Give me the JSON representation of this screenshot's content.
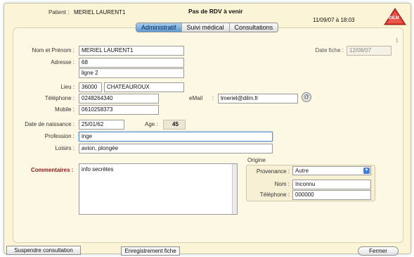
{
  "header": {
    "patient_label": "Patient :",
    "patient_name": "MERIEL LAURENT1",
    "rdv_status": "Pas de RDV à venir",
    "datetime": "11/09/07 à 18:03",
    "logo_text": "DILM"
  },
  "tabs": [
    {
      "label": "Administratif",
      "active": true
    },
    {
      "label": "Suivi médical",
      "active": false
    },
    {
      "label": "Consultations",
      "active": false
    }
  ],
  "page_number": "1",
  "form": {
    "nom_label": "Nom et Prénom :",
    "nom_value": "MERIEL LAURENT1",
    "adresse_label": "Adresse :",
    "adresse_line1": "68",
    "adresse_line2": "ligne 2",
    "lieu_label": "Lieu :",
    "lieu_cp": "36000",
    "lieu_ville": "CHATEAUROUX",
    "telephone_label": "Téléphone :",
    "telephone_value": "0248264340",
    "email_label": "eMail",
    "email_sep": ":",
    "email_value": "lmeriel@dilm.fr",
    "email_btn": "@",
    "mobile_label": "Mobile :",
    "mobile_value": "0610258373",
    "naissance_label": "Date de naissance :",
    "naissance_value": "25/01/62",
    "age_label": "Age :",
    "age_value": "45",
    "profession_label": "Profession :",
    "profession_value": "inge",
    "loisirs_label": "Loisirs :",
    "loisirs_value": "avion, plongée",
    "date_fiche_label": "Date fiche :",
    "date_fiche_value": "12/08/07",
    "commentaires_label": "Commentaires :",
    "commentaires_value": "info secrètes"
  },
  "origine": {
    "title": "Origine",
    "provenance_label": "Provenance :",
    "provenance_value": "Autre",
    "nom_label": "Nom :",
    "nom_value": "Inconnu",
    "telephone_label": "Téléphone :",
    "telephone_value": "000000"
  },
  "footer": {
    "suspendre": "Suspendre consultation",
    "enregistrement": "Enregistrement fiche",
    "fermer": "Fermer"
  },
  "colors": {
    "background": "#fbf4d6",
    "tab_active": "#5d9ad6",
    "commentaires_label": "#8b1a1a",
    "logo": "#d8372d"
  }
}
